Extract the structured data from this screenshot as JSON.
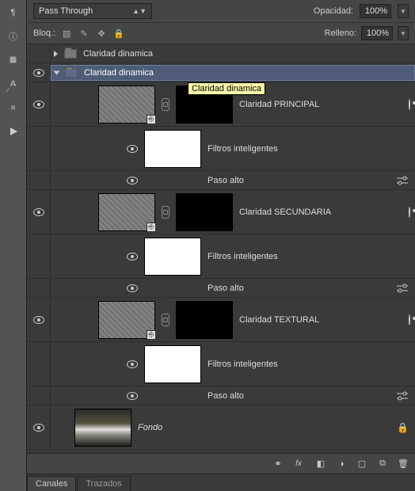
{
  "toolbar": {
    "blend_mode": "Pass Through",
    "opacity_label": "Opacidad:",
    "opacity_value": "100%",
    "lock_label": "Bloq.:",
    "fill_label": "Relleno:",
    "fill_value": "100%"
  },
  "tooltip": "Claridad dinamica",
  "groups": {
    "collapsed": {
      "name": "Claridad dinamica"
    },
    "open": {
      "name": "Claridad dinamica",
      "layers": [
        {
          "name": "Claridad PRINCIPAL",
          "smart_filters_label": "Filtros inteligentes",
          "filter_name": "Paso alto"
        },
        {
          "name": "Claridad SECUNDARIA",
          "smart_filters_label": "Filtros inteligentes",
          "filter_name": "Paso alto"
        },
        {
          "name": "Claridad TEXTURAL",
          "smart_filters_label": "Filtros inteligentes",
          "filter_name": "Paso alto"
        }
      ]
    }
  },
  "background_layer": "Fondo",
  "bottom_fx": "fx",
  "tabs": {
    "canales": "Canales",
    "trazados": "Trazados"
  }
}
